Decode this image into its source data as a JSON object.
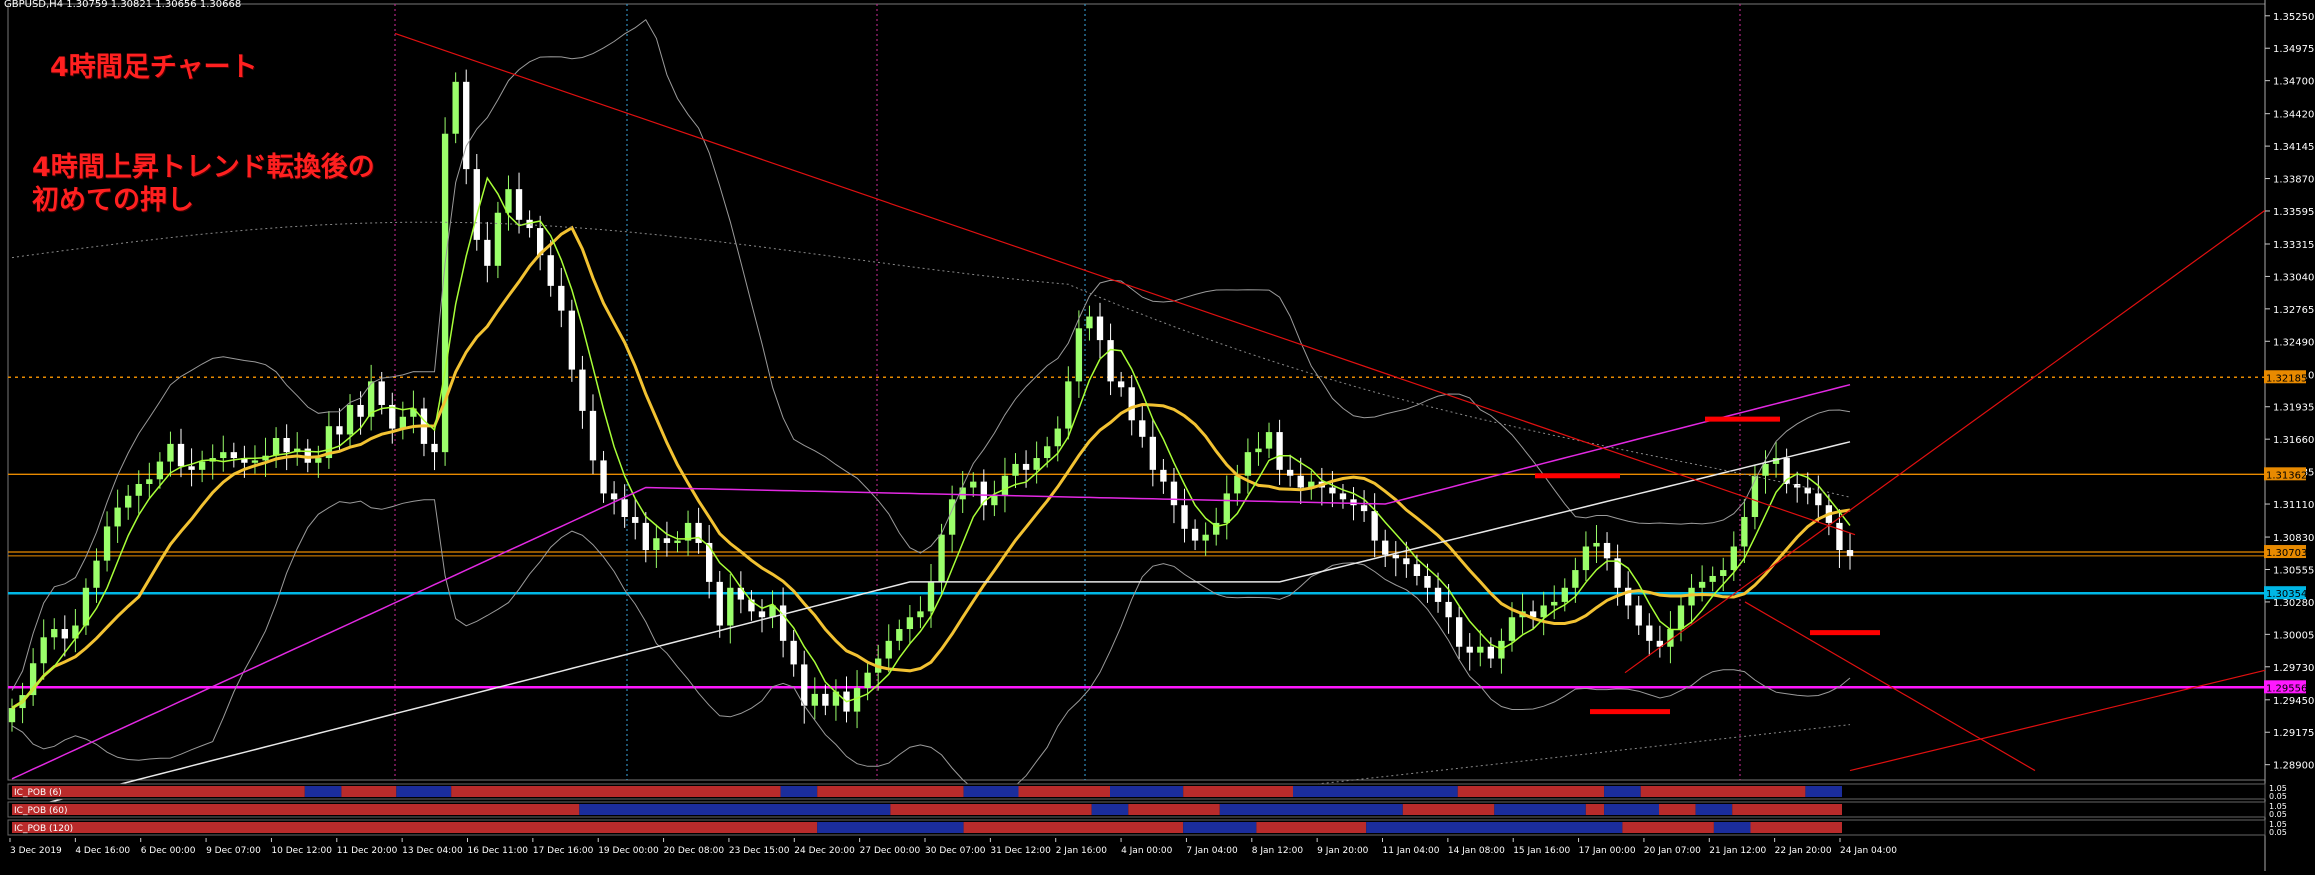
{
  "header": {
    "symbol_line": "GBPUSD,H4  1.30759 1.30821 1.30656 1.30668"
  },
  "annotations": {
    "title": "4時間足チャート",
    "note_line1": "4時間上昇トレンド転換後の",
    "note_line2": "初めての押し"
  },
  "colors": {
    "bg": "#000000",
    "bull": "#9bff6b",
    "bear": "#ffffff",
    "ma_fast": "#a8ff38",
    "ma_slow": "#f2c232",
    "ma_magenta": "#e229e2",
    "ma_white": "#e8e8e8",
    "bband": "#9a9a9a",
    "trend": "#e01010",
    "support_cyan": "#00b7e6",
    "support_magenta": "#ff18ff",
    "resist_orange": "#e88a00",
    "marker": "#ff0000",
    "ind_red": "#b92b2b",
    "ind_blue": "#1b2d9c"
  },
  "chart_data": {
    "type": "candlestick",
    "symbol": "GBPUSD",
    "timeframe": "H4",
    "ohlc_last": {
      "open": 1.30759,
      "high": 1.30821,
      "low": 1.30656,
      "close": 1.30668
    },
    "ylim": [
      1.2877,
      1.3535
    ],
    "y_ticks": [
      1.3525,
      1.34975,
      1.347,
      1.3442,
      1.34145,
      1.3387,
      1.33595,
      1.33315,
      1.3304,
      1.32765,
      1.3249,
      1.3221,
      1.31935,
      1.3166,
      1.31385,
      1.3111,
      1.3083,
      1.30555,
      1.3028,
      1.30005,
      1.2973,
      1.2945,
      1.29175,
      1.289
    ],
    "x_labels": [
      "3 Dec 2019",
      "4 Dec 16:00",
      "6 Dec 00:00",
      "9 Dec 07:00",
      "10 Dec 12:00",
      "11 Dec 20:00",
      "13 Dec 04:00",
      "16 Dec 11:00",
      "17 Dec 16:00",
      "19 Dec 00:00",
      "20 Dec 08:00",
      "23 Dec 15:00",
      "24 Dec 20:00",
      "27 Dec 00:00",
      "30 Dec 07:00",
      "31 Dec 12:00",
      "2 Jan 16:00",
      "4 Jan 00:00",
      "7 Jan 04:00",
      "8 Jan 12:00",
      "9 Jan 20:00",
      "11 Jan 04:00",
      "14 Jan 08:00",
      "15 Jan 16:00",
      "17 Jan 00:00",
      "20 Jan 07:00",
      "21 Jan 12:00",
      "22 Jan 20:00",
      "24 Jan 04:00"
    ],
    "price_labels": [
      {
        "price": 1.32185,
        "text": "1.32185",
        "kind": "orange_dotted"
      },
      {
        "price": 1.31362,
        "text": "1.31362",
        "kind": "orange"
      },
      {
        "price": 1.30703,
        "text": "1.30703",
        "kind": "orange"
      },
      {
        "price": 1.30354,
        "text": "1.30354",
        "kind": "cyan"
      },
      {
        "price": 1.29556,
        "text": "1.29556",
        "kind": "magenta"
      }
    ],
    "series": [
      {
        "name": "close",
        "values": [
          1.2938,
          1.2949,
          1.2976,
          1.2998,
          1.3005,
          1.2997,
          1.3008,
          1.304,
          1.3063,
          1.3092,
          1.3108,
          1.3118,
          1.3128,
          1.3132,
          1.3147,
          1.3162,
          1.3143,
          1.314,
          1.3147,
          1.315,
          1.3155,
          1.315,
          1.3146,
          1.3148,
          1.3152,
          1.3167,
          1.3155,
          1.3158,
          1.3146,
          1.315,
          1.3177,
          1.317,
          1.3195,
          1.3185,
          1.3215,
          1.3195,
          1.3175,
          1.3185,
          1.3192,
          1.3162,
          1.3155,
          1.3425,
          1.3469,
          1.3395,
          1.3335,
          1.3313,
          1.3358,
          1.3378,
          1.3352,
          1.3345,
          1.3322,
          1.3296,
          1.3275,
          1.3225,
          1.319,
          1.3148,
          1.312,
          1.3115,
          1.31,
          1.3095,
          1.3072,
          1.3082,
          1.3078,
          1.308,
          1.3095,
          1.3078,
          1.3045,
          1.3008,
          1.304,
          1.303,
          1.302,
          1.3015,
          1.3025,
          1.2995,
          1.2975,
          1.294,
          1.295,
          1.294,
          1.2952,
          1.2935,
          1.2955,
          1.2968,
          1.298,
          1.2995,
          1.3005,
          1.3015,
          1.302,
          1.3045,
          1.3085,
          1.3115,
          1.3125,
          1.313,
          1.311,
          1.3118,
          1.3135,
          1.3145,
          1.314,
          1.315,
          1.316,
          1.3175,
          1.3215,
          1.326,
          1.327,
          1.325,
          1.3215,
          1.321,
          1.3182,
          1.3168,
          1.314,
          1.313,
          1.311,
          1.309,
          1.308,
          1.3085,
          1.3095,
          1.312,
          1.3135,
          1.3155,
          1.3158,
          1.3172,
          1.314,
          1.3135,
          1.3125,
          1.313,
          1.3125,
          1.312,
          1.3115,
          1.311,
          1.3105,
          1.308,
          1.3068,
          1.3065,
          1.306,
          1.305,
          1.304,
          1.3028,
          1.3015,
          1.299,
          1.2985,
          1.299,
          1.298,
          1.2995,
          1.3015,
          1.302,
          1.3015,
          1.3025,
          1.3028,
          1.304,
          1.3055,
          1.3075,
          1.3078,
          1.3065,
          1.304,
          1.3025,
          1.3008,
          1.2995,
          1.299,
          1.3005,
          1.3025,
          1.304,
          1.3045,
          1.305,
          1.3055,
          1.3075,
          1.31,
          1.3135,
          1.3145,
          1.315,
          1.3128,
          1.3125,
          1.312,
          1.311,
          1.3095,
          1.3072,
          1.3067
        ]
      },
      {
        "name": "ind_strip_1",
        "values": [
          -1,
          1,
          -1,
          1,
          -1,
          1,
          -1,
          1
        ]
      }
    ],
    "indicator_strips": [
      {
        "label": "IC_POB (6)",
        "right_labels": [
          "1.05",
          "0.05"
        ],
        "segments": [
          [
            "r",
            0.16
          ],
          [
            "b",
            0.02
          ],
          [
            "r",
            0.03
          ],
          [
            "b",
            0.03
          ],
          [
            "r",
            0.18
          ],
          [
            "b",
            0.02
          ],
          [
            "r",
            0.08
          ],
          [
            "b",
            0.03
          ],
          [
            "r",
            0.05
          ],
          [
            "b",
            0.04
          ],
          [
            "r",
            0.06
          ],
          [
            "b",
            0.09
          ],
          [
            "r",
            0.08
          ],
          [
            "b",
            0.02
          ],
          [
            "r",
            0.09
          ],
          [
            "b",
            0.02
          ]
        ]
      },
      {
        "label": "IC_POB (60)",
        "right_labels": [
          "1.05",
          "0.05"
        ],
        "segments": [
          [
            "r",
            0.31
          ],
          [
            "b",
            0.17
          ],
          [
            "r",
            0.11
          ],
          [
            "b",
            0.02
          ],
          [
            "r",
            0.05
          ],
          [
            "b",
            0.1
          ],
          [
            "r",
            0.05
          ],
          [
            "b",
            0.05
          ],
          [
            "r",
            0.01
          ],
          [
            "b",
            0.03
          ],
          [
            "r",
            0.02
          ],
          [
            "b",
            0.02
          ],
          [
            "r",
            0.06
          ]
        ]
      },
      {
        "label": "IC_POB (120)",
        "right_labels": [
          "1.05",
          "0.05"
        ],
        "segments": [
          [
            "r",
            0.44
          ],
          [
            "b",
            0.08
          ],
          [
            "r",
            0.12
          ],
          [
            "b",
            0.04
          ],
          [
            "r",
            0.06
          ],
          [
            "b",
            0.14
          ],
          [
            "r",
            0.05
          ],
          [
            "b",
            0.02
          ],
          [
            "r",
            0.05
          ]
        ]
      }
    ]
  }
}
